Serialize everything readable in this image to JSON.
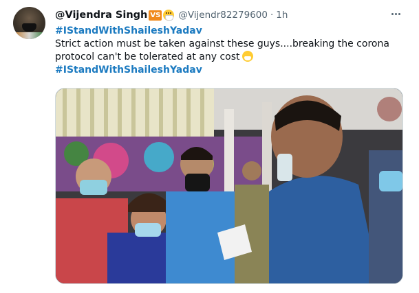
{
  "tweet": {
    "display_name": "@Vijendra Singh",
    "badge": "VS",
    "handle": "@Vijendr82279600",
    "separator": "·",
    "time": "1h",
    "hashtag_top": "#IStandWithShaileshYadav",
    "text_line1": "Strict action must be taken against these guys....breaking the corona",
    "text_line2": "protocol can't be tolerated at any cost",
    "hashtag_bottom": "#IStandWithShaileshYadav"
  },
  "colors": {
    "hashtag": "#1b7ac0",
    "secondary_text": "#536471",
    "badge": "#f08a1c"
  },
  "icons": [
    "profile-avatar",
    "vs-badge",
    "face-with-mask-emoji",
    "more-icon"
  ]
}
